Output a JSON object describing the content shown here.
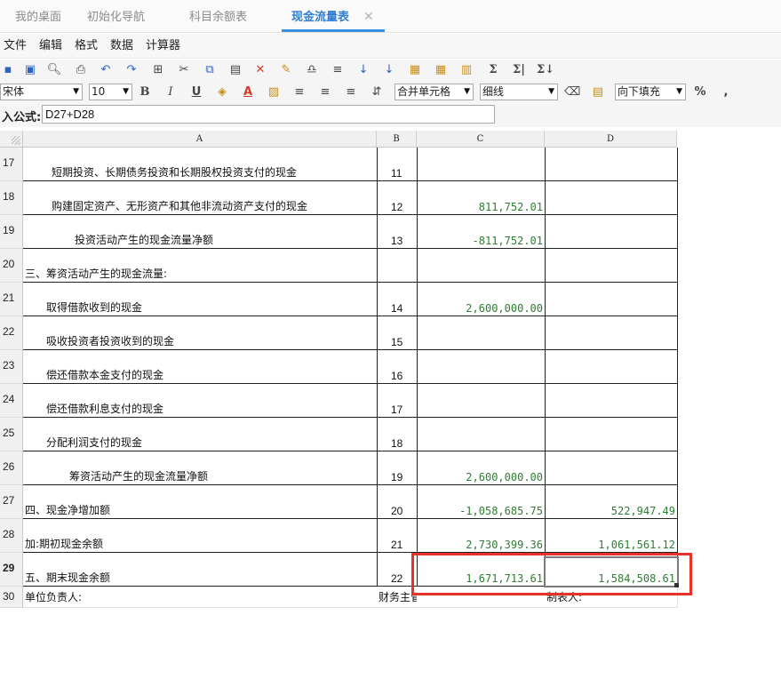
{
  "tabs": [
    {
      "label": "我的桌面",
      "active": false
    },
    {
      "label": "初始化导航",
      "active": false
    },
    {
      "label": "科目余额表",
      "active": false
    },
    {
      "label": "现金流量表",
      "active": true
    }
  ],
  "tab_close_glyph": "✕",
  "menu": [
    "文件",
    "编辑",
    "格式",
    "数据",
    "计算器"
  ],
  "toolbar": {
    "icons_row1": [
      "save-icon",
      "save-as-icon",
      "print-preview-icon",
      "print-icon",
      "undo-icon",
      "redo-icon",
      "insert-grid-icon",
      "cut-icon",
      "copy-icon",
      "paste-icon",
      "delete-icon",
      "format-brush-icon",
      "find-icon",
      "replace-icon",
      "sort-asc-icon",
      "sort-desc-icon",
      "insert-row-icon",
      "insert-column-icon",
      "insert-sheet-icon",
      "sum-icon",
      "sum-row-icon",
      "sum-column-icon"
    ],
    "glyphs_row1": [
      "▪",
      "▣",
      "🔍︎",
      "⎙",
      "↶",
      "↷",
      "⊞",
      "✂",
      "⧉",
      "▤",
      "✕",
      "✎",
      "♎︎",
      "≡",
      "↓",
      "↓",
      "▦",
      "▦",
      "▥",
      "Σ",
      "Σ|",
      "Σ↓"
    ],
    "font_name": "宋体",
    "font_size": "10",
    "bold": "B",
    "italic": "I",
    "underline": "U",
    "fill_color_glyph": "◈",
    "font_color": "A",
    "merge": "合并单元格",
    "line_style": "细线",
    "fill_direction": "向下填充",
    "percent": "%",
    "comma": ","
  },
  "formula": {
    "label": "入公式:",
    "value": "D27+D28"
  },
  "columns": [
    "A",
    "B",
    "C",
    "D"
  ],
  "rows": [
    {
      "num": "17",
      "a": "短期投资、长期债务投资和长期股权投资支付的现金",
      "b": "11",
      "c": "",
      "d": ""
    },
    {
      "num": "18",
      "a": "购建固定资产、无形资产和其他非流动资产支付的现金",
      "b": "12",
      "c": "811,752.01",
      "d": ""
    },
    {
      "num": "19",
      "a": "投资活动产生的现金流量净额",
      "b": "13",
      "c": "-811,752.01",
      "d": ""
    },
    {
      "num": "20",
      "a": "三、筹资活动产生的现金流量:",
      "b": "",
      "c": "",
      "d": ""
    },
    {
      "num": "21",
      "a": "取得借款收到的现金",
      "b": "14",
      "c": "2,600,000.00",
      "d": ""
    },
    {
      "num": "22",
      "a": "吸收投资者投资收到的现金",
      "b": "15",
      "c": "",
      "d": ""
    },
    {
      "num": "23",
      "a": "偿还借款本金支付的现金",
      "b": "16",
      "c": "",
      "d": ""
    },
    {
      "num": "24",
      "a": "偿还借款利息支付的现金",
      "b": "17",
      "c": "",
      "d": ""
    },
    {
      "num": "25",
      "a": "分配利润支付的现金",
      "b": "18",
      "c": "",
      "d": ""
    },
    {
      "num": "26",
      "a": "筹资活动产生的现金流量净额",
      "b": "19",
      "c": "2,600,000.00",
      "d": ""
    },
    {
      "num": "27",
      "a": "四、现金净增加额",
      "b": "20",
      "c": "-1,058,685.75",
      "d": "522,947.49"
    },
    {
      "num": "28",
      "a": "加:期初现金余额",
      "b": "21",
      "c": "2,730,399.36",
      "d": "1,061,561.12"
    },
    {
      "num": "29",
      "a": "五、期末现金余额",
      "b": "22",
      "c": "1,671,713.61",
      "d": "1,584,508.61"
    },
    {
      "num": "30",
      "a": "单位负责人:",
      "b": "财务主管:",
      "c": "",
      "d": "制表人:"
    }
  ],
  "colors": {
    "active_tab": "#2f7fd6",
    "number_text": "#2e7d32",
    "highlight": "#e8312b"
  }
}
